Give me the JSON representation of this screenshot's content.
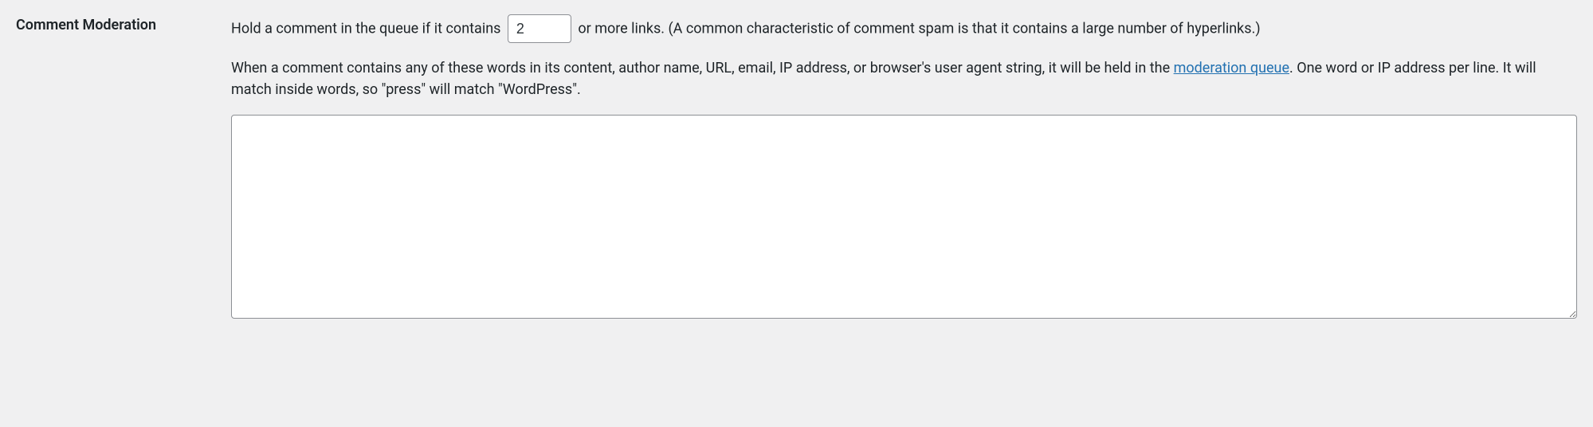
{
  "comment_moderation": {
    "section_title": "Comment Moderation",
    "hold_text_before": "Hold a comment in the queue if it contains ",
    "max_links_value": "2",
    "hold_text_after": " or more links. (A common characteristic of comment spam is that it contains a large number of hyperlinks.)",
    "description_before_link": "When a comment contains any of these words in its content, author name, URL, email, IP address, or browser's user agent string, it will be held in the ",
    "moderation_queue_link_text": "moderation queue",
    "description_after_link": ". One word or IP address per line. It will match inside words, so \"press\" will match \"WordPress\".",
    "moderation_keys_value": ""
  }
}
